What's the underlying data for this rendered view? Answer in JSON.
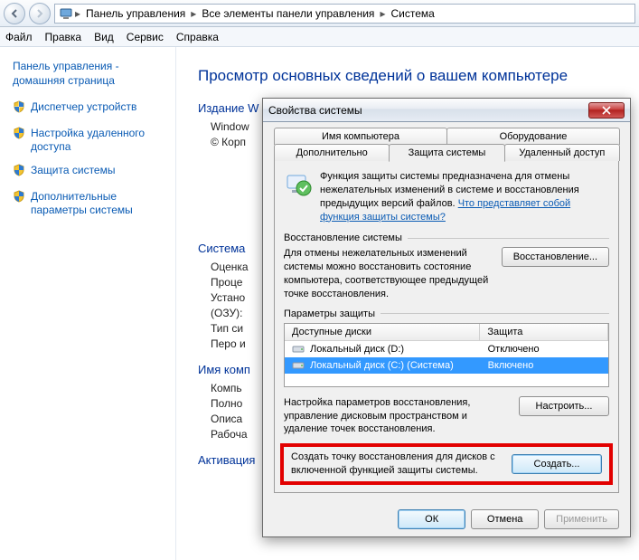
{
  "breadcrumb": {
    "items": [
      "Панель управления",
      "Все элементы панели управления",
      "Система"
    ]
  },
  "menu": [
    "Файл",
    "Правка",
    "Вид",
    "Сервис",
    "Справка"
  ],
  "sidebar": {
    "title": "Панель управления - домашняя страница",
    "links": [
      "Диспетчер устройств",
      "Настройка удаленного доступа",
      "Защита системы",
      "Дополнительные параметры системы"
    ]
  },
  "content": {
    "heading": "Просмотр основных сведений о вашем компьютере",
    "section_edition": "Издание W",
    "edition_lines": [
      "Window",
      "© Корп"
    ],
    "section_system": "Система",
    "system_rows": [
      "Оценка",
      "Проце",
      "Устано",
      "(ОЗУ):",
      "Тип си",
      "Перо и"
    ],
    "section_name": "Имя комп",
    "name_rows": [
      "Компь",
      "Полно",
      "Описа",
      "Рабоча"
    ],
    "section_activation": "Активация"
  },
  "dialog": {
    "title": "Свойства системы",
    "tabs_row1": [
      "Имя компьютера",
      "Оборудование"
    ],
    "tabs_row2": [
      "Дополнительно",
      "Защита системы",
      "Удаленный доступ"
    ],
    "intro": "Функция защиты системы предназначена для отмены нежелательных изменений в системе и восстановления предыдущих версий файлов. ",
    "intro_link": "Что представляет собой функция защиты системы?",
    "restore": {
      "head": "Восстановление системы",
      "text": "Для отмены нежелательных изменений системы можно восстановить состояние компьютера, соответствующее предыдущей точке восстановления.",
      "button": "Восстановление..."
    },
    "params": {
      "head": "Параметры защиты",
      "col_disk": "Доступные диски",
      "col_prot": "Защита",
      "rows": [
        {
          "name": "Локальный диск (D:)",
          "prot": "Отключено",
          "selected": false
        },
        {
          "name": "Локальный диск (C:) (Система)",
          "prot": "Включено",
          "selected": true
        }
      ],
      "config_text": "Настройка параметров восстановления, управление дисковым пространством и удаление точек восстановления.",
      "config_btn": "Настроить...",
      "create_text": "Создать точку восстановления для дисков с включенной функцией защиты системы.",
      "create_btn": "Создать..."
    },
    "footer": {
      "ok": "ОК",
      "cancel": "Отмена",
      "apply": "Применить"
    }
  }
}
